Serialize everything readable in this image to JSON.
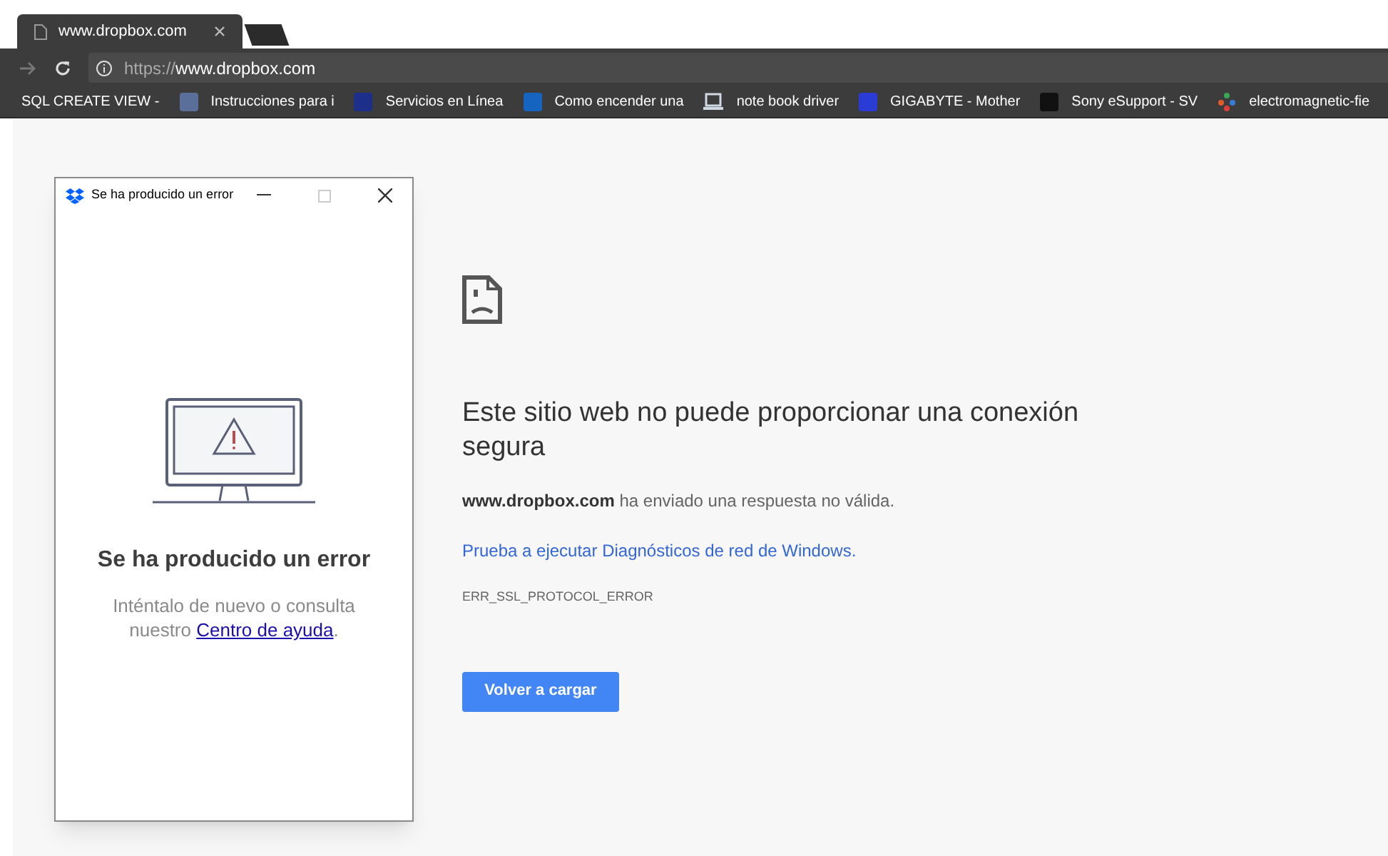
{
  "tab": {
    "title": "www.dropbox.com",
    "selected": true
  },
  "address_bar": {
    "scheme": "https://",
    "host": "www.dropbox.com"
  },
  "bookmarks": [
    {
      "kind": "none",
      "label": "SQL CREATE VIEW -"
    },
    {
      "kind": "badge",
      "color": "#5a6f9a",
      "label": "Instrucciones para i"
    },
    {
      "kind": "badge",
      "color": "#1c2f8a",
      "label": "Servicios en Línea"
    },
    {
      "kind": "badge",
      "color": "#1565c0",
      "label": "Como encender una"
    },
    {
      "kind": "laptop",
      "label": "note book driver"
    },
    {
      "kind": "badge",
      "color": "#2a3bd6",
      "label": "GIGABYTE - Mother"
    },
    {
      "kind": "badge",
      "color": "#111111",
      "label": "Sony eSupport - SV"
    },
    {
      "kind": "dots",
      "label": "electromagnetic-fie"
    }
  ],
  "dialog": {
    "title": "Se ha producido un error",
    "heading": "Se ha producido un error",
    "message": "Inténtalo de nuevo o consulta nuestro",
    "link": "Centro de ayuda",
    "end": "."
  },
  "error_page": {
    "heading": "Este sitio web no puede proporcionar una conexión segura",
    "host": "www.dropbox.com",
    "message": "ha enviado una respuesta no válida.",
    "link": "Prueba a ejecutar Diagnósticos de red de Windows.",
    "code": "ERR_SSL_PROTOCOL_ERROR",
    "button": "Volver a cargar"
  }
}
